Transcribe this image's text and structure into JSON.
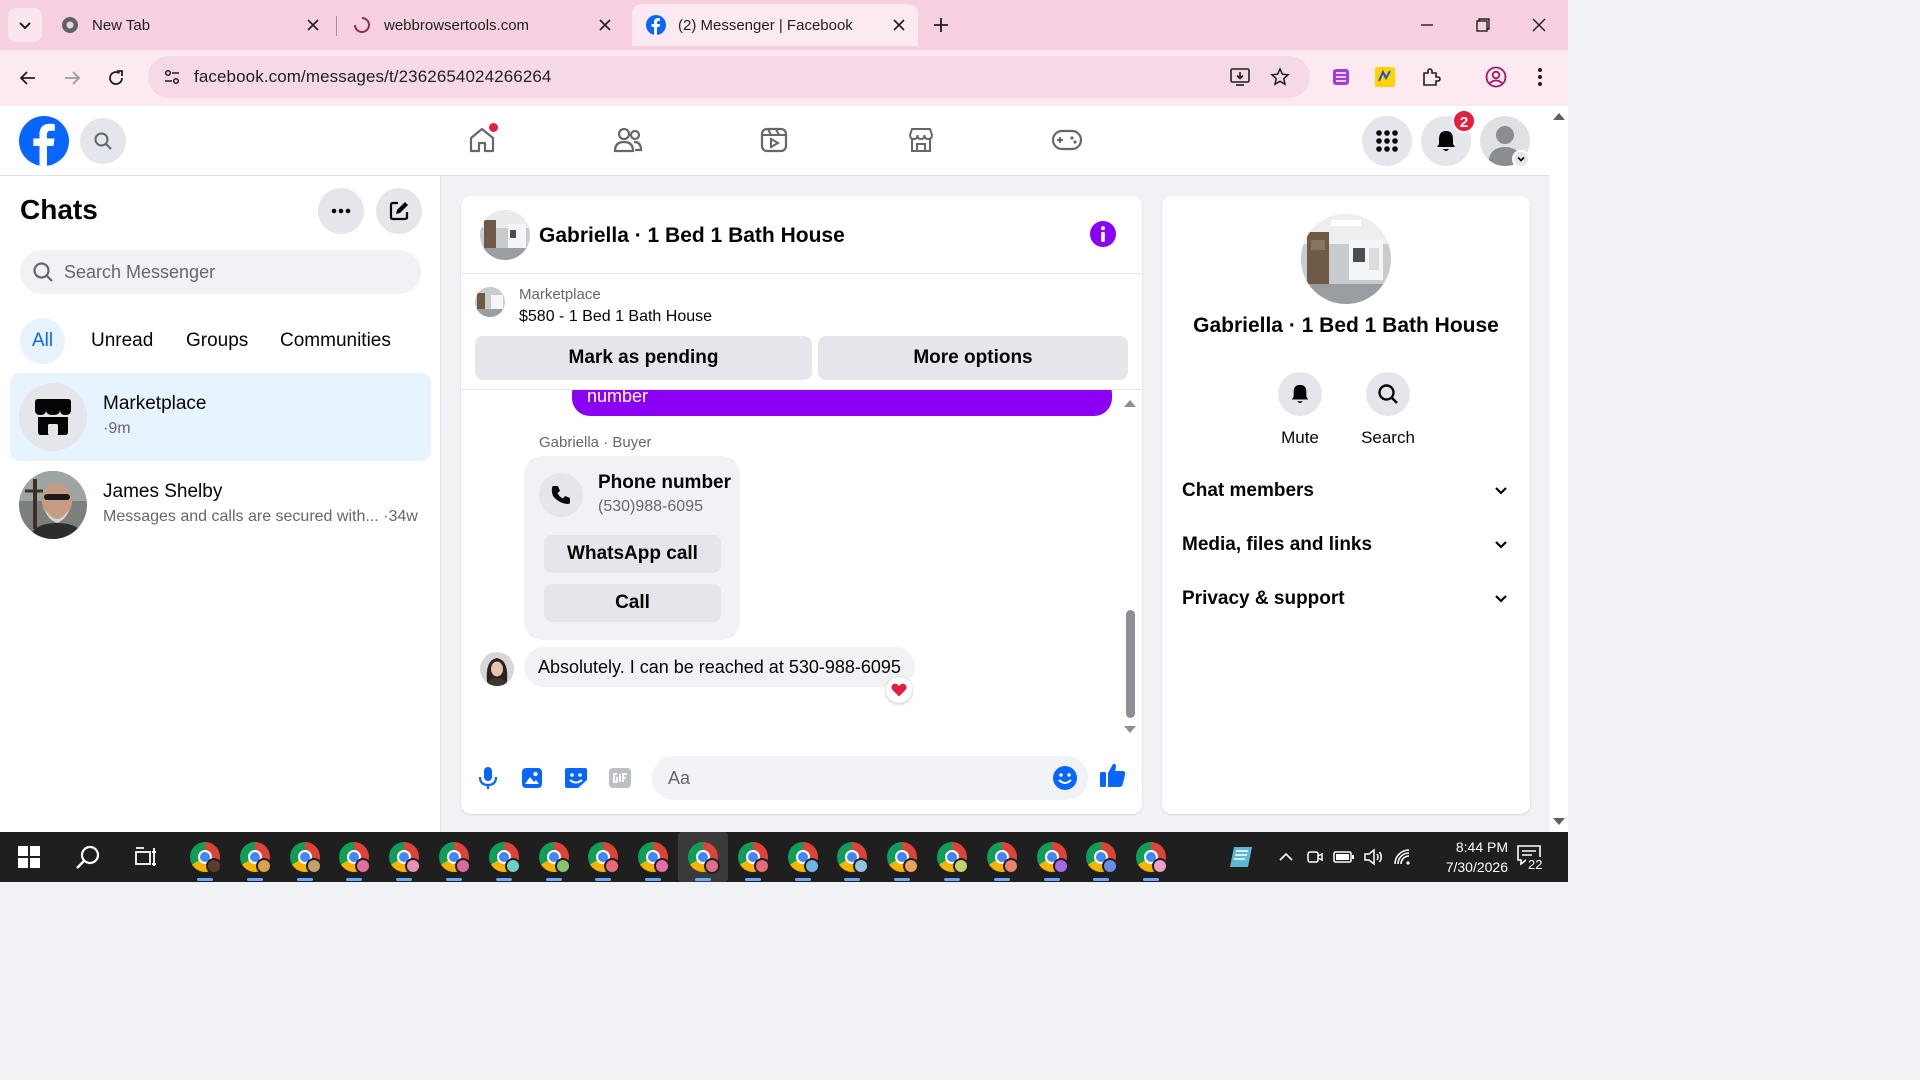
{
  "browser": {
    "tabs": [
      {
        "title": "New Tab"
      },
      {
        "title": "webbrowsertools.com"
      },
      {
        "title": "(2) Messenger | Facebook"
      }
    ],
    "url": "facebook.com/messages/t/2362654024266264"
  },
  "fb_header": {
    "notification_count": "2"
  },
  "left": {
    "title": "Chats",
    "search_placeholder": "Search Messenger",
    "filters": [
      "All",
      "Unread",
      "Groups",
      "Communities"
    ],
    "chats": [
      {
        "name": "Marketplace",
        "sub": "·9m"
      },
      {
        "name": "James Shelby",
        "sub": "Messages and calls are secured with... ·34w"
      }
    ]
  },
  "conversation": {
    "title": "Gabriella · 1 Bed 1 Bath House",
    "marketplace_label": "Marketplace",
    "listing": "$580 - 1 Bed 1 Bath House",
    "mark_pending": "Mark as pending",
    "more_options": "More options",
    "sent_partial": "number",
    "sender_label": "Gabriella · Buyer",
    "phone_card": {
      "title": "Phone number",
      "number": "(530)988-6095",
      "whatsapp": "WhatsApp call",
      "call": "Call"
    },
    "received_message": "Absolutely. I can be reached at 530-988-6095",
    "composer_placeholder": "Aa"
  },
  "right_panel": {
    "name": "Gabriella · 1 Bed 1 Bath House",
    "actions": [
      "Mute",
      "Search"
    ],
    "sections": [
      "Chat members",
      "Media, files and links",
      "Privacy & support"
    ]
  },
  "taskbar": {
    "time": "8:44 PM",
    "date": "7/30/2026",
    "notifications": "22"
  },
  "colors": {
    "fb_blue": "#0866ff",
    "messenger_purple": "#8a00f5",
    "chrome_tab_bg": "#f6cfe0"
  }
}
